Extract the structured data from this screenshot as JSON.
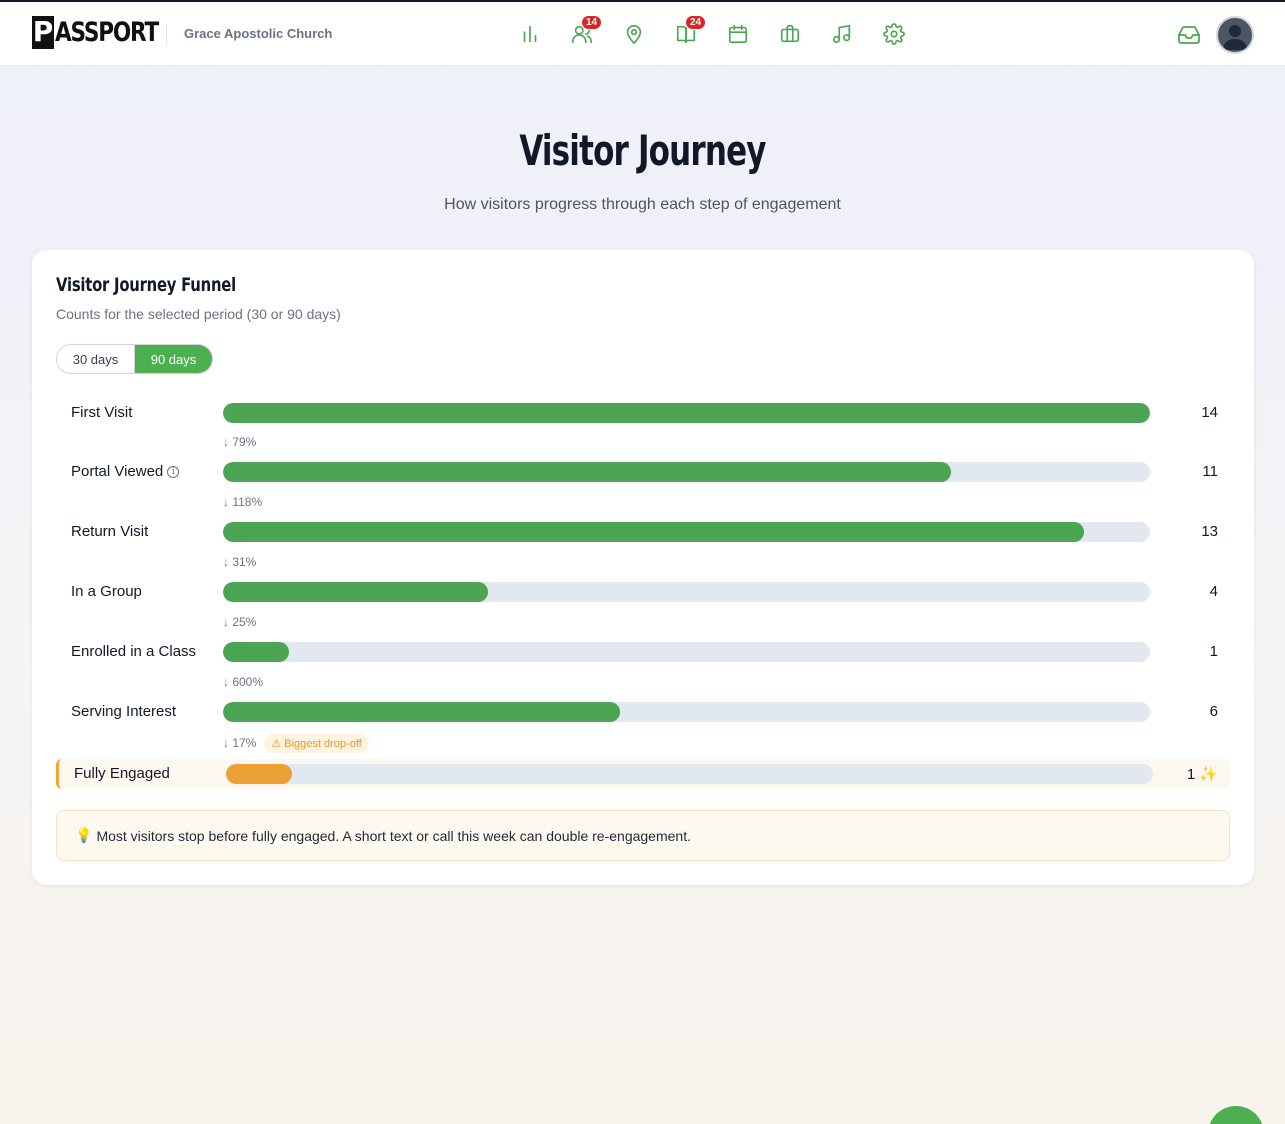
{
  "brand": {
    "logo_letter": "P",
    "logo_rest": "ASSPORT",
    "church": "Grace Apostolic Church"
  },
  "nav": [
    {
      "name": "reports-icon",
      "badge": ""
    },
    {
      "name": "people-icon",
      "badge": "14"
    },
    {
      "name": "location-pin-icon",
      "badge": ""
    },
    {
      "name": "book-icon",
      "badge": "24"
    },
    {
      "name": "calendar-icon",
      "badge": ""
    },
    {
      "name": "briefcase-icon",
      "badge": ""
    },
    {
      "name": "music-icon",
      "badge": ""
    },
    {
      "name": "gear-icon",
      "badge": ""
    }
  ],
  "colors": {
    "accent": "#4ca553",
    "highlight": "#eba135",
    "track": "#e2e8f0",
    "badge": "#dc2626"
  },
  "page": {
    "title": "Visitor Journey",
    "subtitle": "How visitors progress through each step of engagement"
  },
  "card": {
    "title": "Visitor Journey Funnel",
    "subtitle": "Counts for the selected period (30 or 90 days)",
    "toggle": {
      "options": [
        "30 days",
        "90 days"
      ],
      "selected": "90 days"
    },
    "max": 14,
    "stages": [
      {
        "label": "First Visit",
        "count": "14",
        "value": 14,
        "info": false
      },
      {
        "label": "Portal Viewed",
        "count": "11",
        "value": 11,
        "info": true
      },
      {
        "label": "Return Visit",
        "count": "13",
        "value": 13,
        "info": false
      },
      {
        "label": "In a Group",
        "count": "4",
        "value": 4,
        "info": false
      },
      {
        "label": "Enrolled in a Class",
        "count": "1",
        "value": 1,
        "info": false
      },
      {
        "label": "Serving Interest",
        "count": "6",
        "value": 6,
        "info": false
      },
      {
        "label": "Fully Engaged",
        "count": "1 ✨",
        "value": 1,
        "info": false,
        "highlight": true
      }
    ],
    "conversions": [
      "↓ 79%",
      "↓ 118%",
      "↓ 31%",
      "↓ 25%",
      "↓ 600%",
      "↓ 17%"
    ],
    "dropoff_label": "⚠ Biggest drop-off",
    "dropoff_index": 5,
    "tip_icon": "💡",
    "tip": "Most visitors stop before fully engaged. A short text or call this week can double re-engagement."
  }
}
